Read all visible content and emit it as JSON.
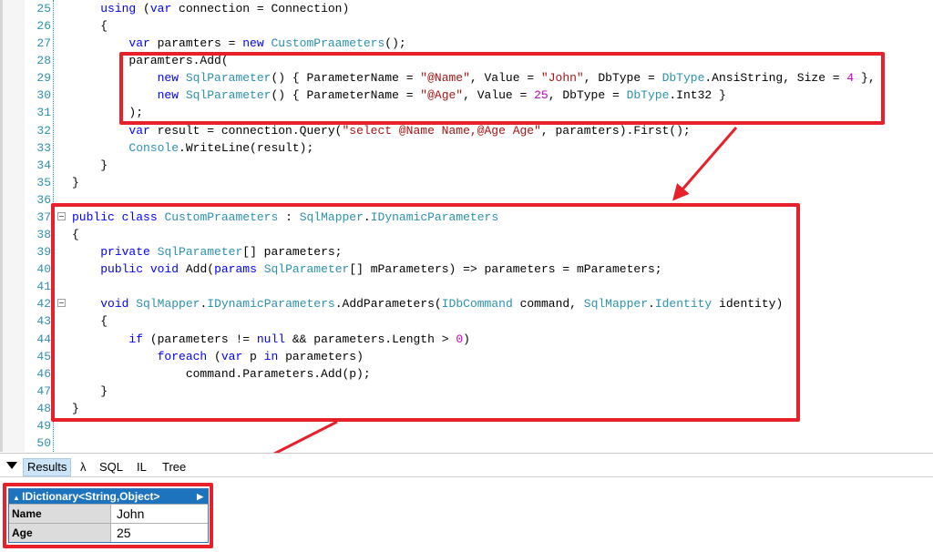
{
  "code_lines": [
    {
      "n": "25",
      "t": [
        [
          "    "
        ],
        [
          "using",
          "kw"
        ],
        [
          " ("
        ],
        [
          "var",
          "kw"
        ],
        [
          " connection = Connection)"
        ]
      ]
    },
    {
      "n": "26",
      "t": [
        [
          "    {"
        ]
      ]
    },
    {
      "n": "27",
      "t": [
        [
          "        "
        ],
        [
          "var",
          "kw"
        ],
        [
          " paramters = "
        ],
        [
          "new",
          "kw"
        ],
        [
          " "
        ],
        [
          "CustomPraameters",
          "ty"
        ],
        [
          "();"
        ]
      ]
    },
    {
      "n": "28",
      "t": [
        [
          "        paramters.Add("
        ]
      ]
    },
    {
      "n": "29",
      "t": [
        [
          "            "
        ],
        [
          "new",
          "kw"
        ],
        [
          " "
        ],
        [
          "SqlParameter",
          "ty"
        ],
        [
          "() { ParameterName = "
        ],
        [
          "\"@Name\"",
          "st"
        ],
        [
          ", Value = "
        ],
        [
          "\"John\"",
          "st"
        ],
        [
          ", DbType = "
        ],
        [
          "DbType",
          "ty"
        ],
        [
          ".AnsiString, Size = "
        ],
        [
          "4",
          "nu"
        ],
        [
          " },"
        ]
      ]
    },
    {
      "n": "30",
      "t": [
        [
          "            "
        ],
        [
          "new",
          "kw"
        ],
        [
          " "
        ],
        [
          "SqlParameter",
          "ty"
        ],
        [
          "() { ParameterName = "
        ],
        [
          "\"@Age\"",
          "st"
        ],
        [
          ", Value = "
        ],
        [
          "25",
          "nu"
        ],
        [
          ", DbType = "
        ],
        [
          "DbType",
          "ty"
        ],
        [
          ".Int32 }"
        ]
      ]
    },
    {
      "n": "31",
      "t": [
        [
          "        );"
        ]
      ]
    },
    {
      "n": "32",
      "t": [
        [
          "        "
        ],
        [
          "var",
          "kw"
        ],
        [
          " result = connection.Query("
        ],
        [
          "\"select @Name Name,@Age Age\"",
          "st"
        ],
        [
          ", paramters).First();"
        ]
      ]
    },
    {
      "n": "33",
      "t": [
        [
          "        "
        ],
        [
          "Console",
          "ty"
        ],
        [
          ".WriteLine(result);"
        ]
      ]
    },
    {
      "n": "34",
      "t": [
        [
          "    }"
        ]
      ]
    },
    {
      "n": "35",
      "t": [
        [
          "}"
        ]
      ]
    },
    {
      "n": "36",
      "t": []
    },
    {
      "n": "37",
      "fold": true,
      "t": [
        [
          "public",
          "kw"
        ],
        [
          " "
        ],
        [
          "class",
          "kw"
        ],
        [
          " "
        ],
        [
          "CustomPraameters",
          "ty"
        ],
        [
          " : "
        ],
        [
          "SqlMapper",
          "ty"
        ],
        [
          "."
        ],
        [
          "IDynamicParameters",
          "ty"
        ]
      ]
    },
    {
      "n": "38",
      "t": [
        [
          "{"
        ]
      ]
    },
    {
      "n": "39",
      "t": [
        [
          "    "
        ],
        [
          "private",
          "kw"
        ],
        [
          " "
        ],
        [
          "SqlParameter",
          "ty"
        ],
        [
          "[] parameters;"
        ]
      ]
    },
    {
      "n": "40",
      "t": [
        [
          "    "
        ],
        [
          "public",
          "kw"
        ],
        [
          " "
        ],
        [
          "void",
          "kw"
        ],
        [
          " Add("
        ],
        [
          "params",
          "kw"
        ],
        [
          " "
        ],
        [
          "SqlParameter",
          "ty"
        ],
        [
          "[] mParameters) => parameters = mParameters;"
        ]
      ]
    },
    {
      "n": "41",
      "t": []
    },
    {
      "n": "42",
      "fold": true,
      "t": [
        [
          "    "
        ],
        [
          "void",
          "kw"
        ],
        [
          " "
        ],
        [
          "SqlMapper",
          "ty"
        ],
        [
          "."
        ],
        [
          "IDynamicParameters",
          "ty"
        ],
        [
          ".AddParameters("
        ],
        [
          "IDbCommand",
          "ty"
        ],
        [
          " command, "
        ],
        [
          "SqlMapper",
          "ty"
        ],
        [
          "."
        ],
        [
          "Identity",
          "ty"
        ],
        [
          " identity)"
        ]
      ]
    },
    {
      "n": "43",
      "t": [
        [
          "    {"
        ]
      ]
    },
    {
      "n": "44",
      "t": [
        [
          "        "
        ],
        [
          "if",
          "kw"
        ],
        [
          " (parameters != "
        ],
        [
          "null",
          "kw"
        ],
        [
          " && parameters.Length > "
        ],
        [
          "0",
          "nu"
        ],
        [
          ")"
        ]
      ]
    },
    {
      "n": "45",
      "t": [
        [
          "            "
        ],
        [
          "foreach",
          "kw"
        ],
        [
          " ("
        ],
        [
          "var",
          "kw"
        ],
        [
          " p "
        ],
        [
          "in",
          "kw"
        ],
        [
          " parameters)"
        ]
      ]
    },
    {
      "n": "46",
      "t": [
        [
          "                command.Parameters.Add(p);"
        ]
      ]
    },
    {
      "n": "47",
      "t": [
        [
          "    }"
        ]
      ]
    },
    {
      "n": "48",
      "t": [
        [
          "}"
        ]
      ]
    },
    {
      "n": "49",
      "t": []
    },
    {
      "n": "50",
      "t": []
    }
  ],
  "results_panel": {
    "tabs": [
      "Results",
      "λ",
      "SQL",
      "IL",
      "Tree"
    ],
    "active_tab": "Results",
    "dictionary": {
      "header": "IDictionary<String,Object>",
      "rows": [
        {
          "key": "Name",
          "value": "John"
        },
        {
          "key": "Age",
          "value": "25"
        }
      ]
    }
  },
  "colors": {
    "highlight_box": "#e8202a",
    "keyword": "#0000ff",
    "type": "#2b91af",
    "string": "#a31515",
    "number": "#c000c0",
    "result_header": "#1e73be"
  }
}
